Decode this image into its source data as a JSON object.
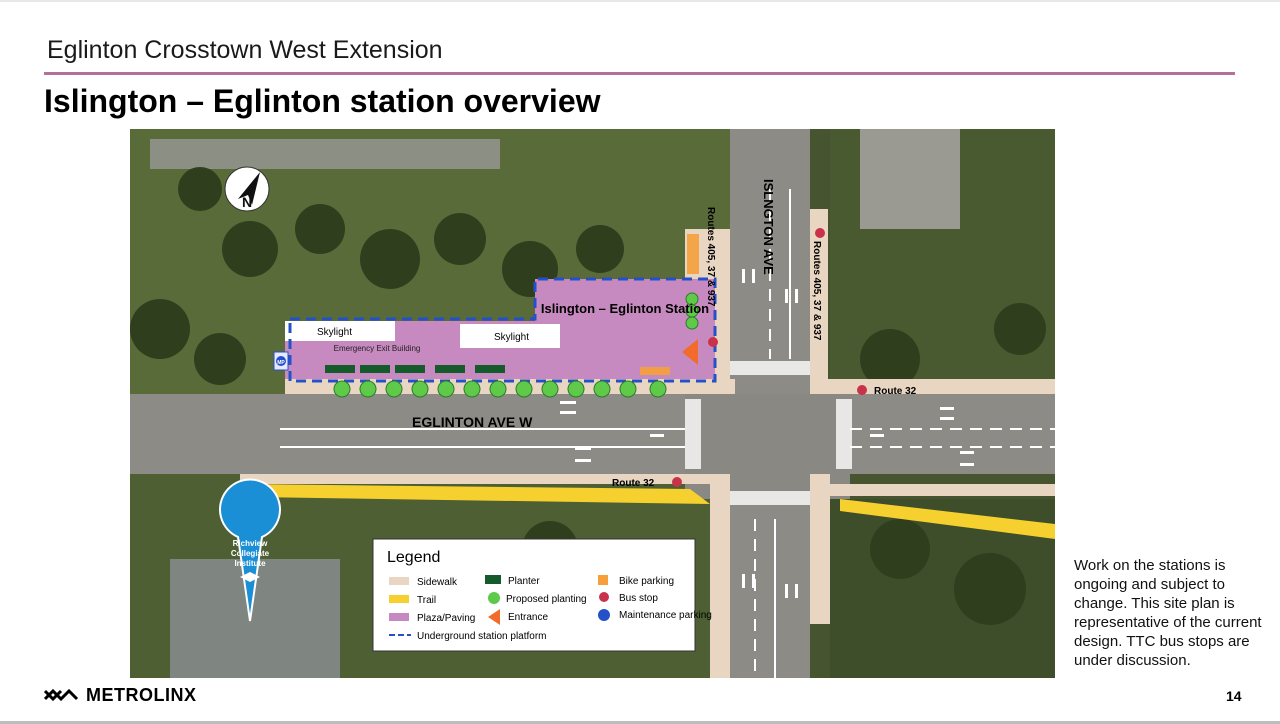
{
  "header": {
    "section_title": "Eglinton Crosstown West Extension",
    "slide_title": "Islington – Eglinton station overview"
  },
  "map": {
    "station_label": "Islington – Eglinton Station",
    "skylight_1": "Skylight",
    "skylight_2": "Skylight",
    "emergency_exit": "Emergency Exit Building",
    "street_islington": "ISLNGTON AVE",
    "street_eglinton": "EGLINTON AVE W",
    "routes_left": "Routes 405, 37 & 937",
    "routes_right": "Routes 405, 37 & 937",
    "route32_north": "Route 32",
    "route32_south": "Route 32",
    "school_label_1": "Richview",
    "school_label_2": "Collegiate",
    "school_label_3": "Institute",
    "compass_letter": "N",
    "maintenance_badge": "MP"
  },
  "legend": {
    "title": "Legend",
    "items": {
      "sidewalk": "Sidewalk",
      "trail": "Trail",
      "plaza": "Plaza/Paving",
      "platform": "Underground station platform",
      "planter": "Planter",
      "planting": "Proposed planting",
      "entrance": "Entrance",
      "bike": "Bike parking",
      "bus": "Bus stop",
      "maintenance": "Maintenance parking"
    }
  },
  "note": "Work on the stations is ongoing and subject to change. This site plan is representative of the current design.  TTC bus stops are under discussion.",
  "footer": {
    "logo": "METROLINX",
    "page_number": "14"
  },
  "colors": {
    "accent_rule": "#b5709a",
    "plaza": "#c78ac0",
    "sidewalk": "#e8d6c2",
    "trail": "#f5d02e",
    "planter": "#145a2a",
    "planting": "#5fc94a",
    "entrance": "#f26b2a",
    "bus_stop": "#c8324a",
    "platform_outline": "#2450c8",
    "school_pin": "#1a8fd6"
  }
}
